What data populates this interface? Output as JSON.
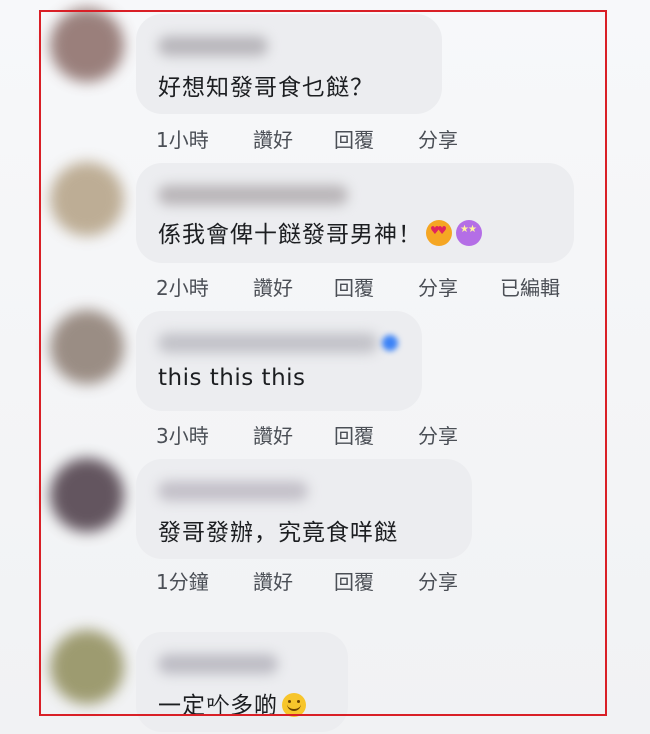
{
  "comments": [
    {
      "text": "好想知發哥食乜餸？",
      "time": "1小時",
      "like": "讚好",
      "reply": "回覆",
      "share": "分享",
      "avatar_color": "#8a6b66",
      "emojis": []
    },
    {
      "text": "係我會俾十餸發哥男神！",
      "time": "2小時",
      "like": "讚好",
      "reply": "回覆",
      "share": "分享",
      "edited": "已編輯",
      "avatar_color": "#b4a184",
      "emojis": [
        "heart-eyes-emoji",
        "star-struck-emoji"
      ]
    },
    {
      "text": "this this this",
      "time": "3小時",
      "like": "讚好",
      "reply": "回覆",
      "share": "分享",
      "avatar_color": "#8b7b70",
      "emojis": []
    },
    {
      "text": "發哥發辦，究竟食咩餸",
      "time": "1分鐘",
      "like": "讚好",
      "reply": "回覆",
      "share": "分享",
      "avatar_color": "#4b3a45",
      "emojis": []
    },
    {
      "text": "一定𠮶多啲",
      "time": "",
      "like": "",
      "reply": "",
      "share": "",
      "avatar_color": "#8f8c59",
      "emojis": [
        "smiling-emoji"
      ]
    }
  ],
  "colors": {
    "highlight_border": "#d91f26",
    "bubble": "#ecedf0",
    "action_text": "#4b4f56"
  }
}
